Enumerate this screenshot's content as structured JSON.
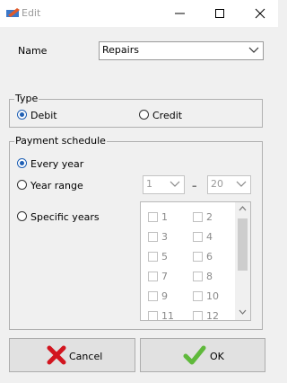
{
  "window": {
    "title": "Edit",
    "app_icon": "ledger-pen-icon",
    "controls": [
      "minimize-icon",
      "maximize-icon",
      "close-icon"
    ]
  },
  "name_field": {
    "label": "Name",
    "value": "Repairs"
  },
  "type_group": {
    "title": "Type",
    "options": [
      "Debit",
      "Credit"
    ],
    "selected": "Debit"
  },
  "payment_schedule": {
    "title": "Payment schedule",
    "options": [
      "Every year",
      "Year range",
      "Specific years"
    ],
    "selected": "Every year",
    "year_range": {
      "from": "1",
      "separator": "–",
      "to": "20"
    },
    "specific_years": [
      "1",
      "2",
      "3",
      "4",
      "5",
      "6",
      "7",
      "8",
      "9",
      "10",
      "11",
      "12"
    ]
  },
  "buttons": {
    "cancel": "Cancel",
    "ok": "OK"
  },
  "colors": {
    "radio_selected": "#1f5fb4",
    "cancel_icon": "#d2151f",
    "ok_icon": "#5fb93b"
  }
}
